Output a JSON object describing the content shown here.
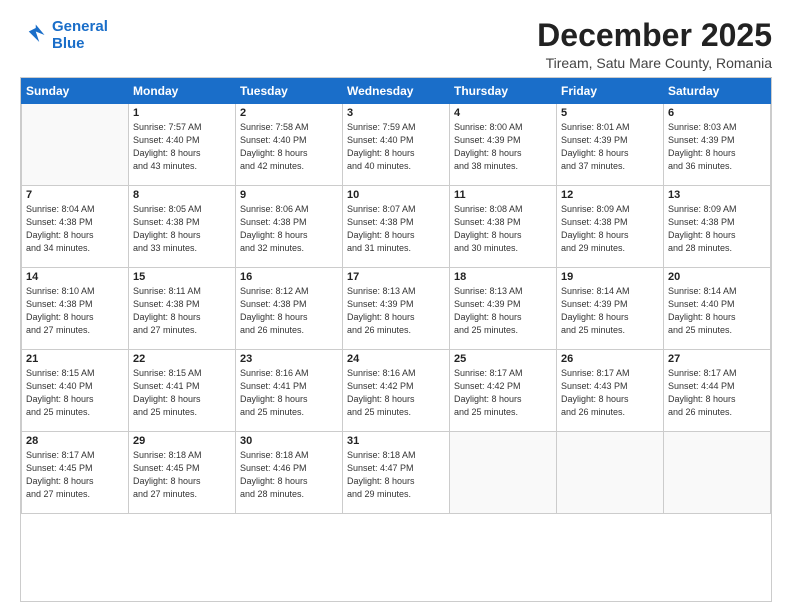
{
  "header": {
    "logo_line1": "General",
    "logo_line2": "Blue",
    "main_title": "December 2025",
    "subtitle": "Tiream, Satu Mare County, Romania"
  },
  "calendar": {
    "days_of_week": [
      "Sunday",
      "Monday",
      "Tuesday",
      "Wednesday",
      "Thursday",
      "Friday",
      "Saturday"
    ],
    "weeks": [
      [
        {
          "day": "",
          "info": ""
        },
        {
          "day": "1",
          "info": "Sunrise: 7:57 AM\nSunset: 4:40 PM\nDaylight: 8 hours\nand 43 minutes."
        },
        {
          "day": "2",
          "info": "Sunrise: 7:58 AM\nSunset: 4:40 PM\nDaylight: 8 hours\nand 42 minutes."
        },
        {
          "day": "3",
          "info": "Sunrise: 7:59 AM\nSunset: 4:40 PM\nDaylight: 8 hours\nand 40 minutes."
        },
        {
          "day": "4",
          "info": "Sunrise: 8:00 AM\nSunset: 4:39 PM\nDaylight: 8 hours\nand 38 minutes."
        },
        {
          "day": "5",
          "info": "Sunrise: 8:01 AM\nSunset: 4:39 PM\nDaylight: 8 hours\nand 37 minutes."
        },
        {
          "day": "6",
          "info": "Sunrise: 8:03 AM\nSunset: 4:39 PM\nDaylight: 8 hours\nand 36 minutes."
        }
      ],
      [
        {
          "day": "7",
          "info": "Sunrise: 8:04 AM\nSunset: 4:38 PM\nDaylight: 8 hours\nand 34 minutes."
        },
        {
          "day": "8",
          "info": "Sunrise: 8:05 AM\nSunset: 4:38 PM\nDaylight: 8 hours\nand 33 minutes."
        },
        {
          "day": "9",
          "info": "Sunrise: 8:06 AM\nSunset: 4:38 PM\nDaylight: 8 hours\nand 32 minutes."
        },
        {
          "day": "10",
          "info": "Sunrise: 8:07 AM\nSunset: 4:38 PM\nDaylight: 8 hours\nand 31 minutes."
        },
        {
          "day": "11",
          "info": "Sunrise: 8:08 AM\nSunset: 4:38 PM\nDaylight: 8 hours\nand 30 minutes."
        },
        {
          "day": "12",
          "info": "Sunrise: 8:09 AM\nSunset: 4:38 PM\nDaylight: 8 hours\nand 29 minutes."
        },
        {
          "day": "13",
          "info": "Sunrise: 8:09 AM\nSunset: 4:38 PM\nDaylight: 8 hours\nand 28 minutes."
        }
      ],
      [
        {
          "day": "14",
          "info": "Sunrise: 8:10 AM\nSunset: 4:38 PM\nDaylight: 8 hours\nand 27 minutes."
        },
        {
          "day": "15",
          "info": "Sunrise: 8:11 AM\nSunset: 4:38 PM\nDaylight: 8 hours\nand 27 minutes."
        },
        {
          "day": "16",
          "info": "Sunrise: 8:12 AM\nSunset: 4:38 PM\nDaylight: 8 hours\nand 26 minutes."
        },
        {
          "day": "17",
          "info": "Sunrise: 8:13 AM\nSunset: 4:39 PM\nDaylight: 8 hours\nand 26 minutes."
        },
        {
          "day": "18",
          "info": "Sunrise: 8:13 AM\nSunset: 4:39 PM\nDaylight: 8 hours\nand 25 minutes."
        },
        {
          "day": "19",
          "info": "Sunrise: 8:14 AM\nSunset: 4:39 PM\nDaylight: 8 hours\nand 25 minutes."
        },
        {
          "day": "20",
          "info": "Sunrise: 8:14 AM\nSunset: 4:40 PM\nDaylight: 8 hours\nand 25 minutes."
        }
      ],
      [
        {
          "day": "21",
          "info": "Sunrise: 8:15 AM\nSunset: 4:40 PM\nDaylight: 8 hours\nand 25 minutes."
        },
        {
          "day": "22",
          "info": "Sunrise: 8:15 AM\nSunset: 4:41 PM\nDaylight: 8 hours\nand 25 minutes."
        },
        {
          "day": "23",
          "info": "Sunrise: 8:16 AM\nSunset: 4:41 PM\nDaylight: 8 hours\nand 25 minutes."
        },
        {
          "day": "24",
          "info": "Sunrise: 8:16 AM\nSunset: 4:42 PM\nDaylight: 8 hours\nand 25 minutes."
        },
        {
          "day": "25",
          "info": "Sunrise: 8:17 AM\nSunset: 4:42 PM\nDaylight: 8 hours\nand 25 minutes."
        },
        {
          "day": "26",
          "info": "Sunrise: 8:17 AM\nSunset: 4:43 PM\nDaylight: 8 hours\nand 26 minutes."
        },
        {
          "day": "27",
          "info": "Sunrise: 8:17 AM\nSunset: 4:44 PM\nDaylight: 8 hours\nand 26 minutes."
        }
      ],
      [
        {
          "day": "28",
          "info": "Sunrise: 8:17 AM\nSunset: 4:45 PM\nDaylight: 8 hours\nand 27 minutes."
        },
        {
          "day": "29",
          "info": "Sunrise: 8:18 AM\nSunset: 4:45 PM\nDaylight: 8 hours\nand 27 minutes."
        },
        {
          "day": "30",
          "info": "Sunrise: 8:18 AM\nSunset: 4:46 PM\nDaylight: 8 hours\nand 28 minutes."
        },
        {
          "day": "31",
          "info": "Sunrise: 8:18 AM\nSunset: 4:47 PM\nDaylight: 8 hours\nand 29 minutes."
        },
        {
          "day": "",
          "info": ""
        },
        {
          "day": "",
          "info": ""
        },
        {
          "day": "",
          "info": ""
        }
      ]
    ]
  }
}
